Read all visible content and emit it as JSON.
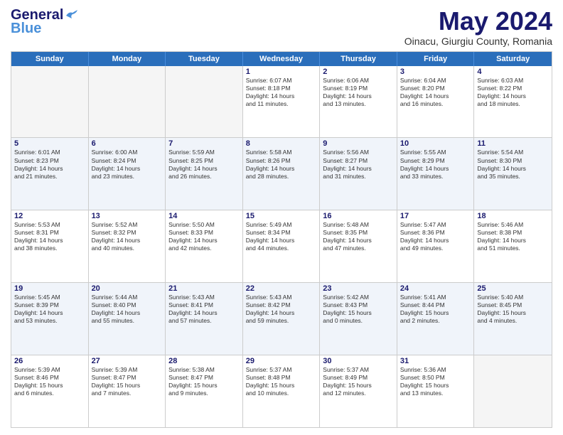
{
  "header": {
    "logo_line1": "General",
    "logo_line2": "Blue",
    "main_title": "May 2024",
    "subtitle": "Oinacu, Giurgiu County, Romania"
  },
  "calendar": {
    "days_of_week": [
      "Sunday",
      "Monday",
      "Tuesday",
      "Wednesday",
      "Thursday",
      "Friday",
      "Saturday"
    ],
    "weeks": [
      {
        "alt": false,
        "cells": [
          {
            "day": "",
            "empty": true,
            "lines": []
          },
          {
            "day": "",
            "empty": true,
            "lines": []
          },
          {
            "day": "",
            "empty": true,
            "lines": []
          },
          {
            "day": "1",
            "empty": false,
            "lines": [
              "Sunrise: 6:07 AM",
              "Sunset: 8:18 PM",
              "Daylight: 14 hours",
              "and 11 minutes."
            ]
          },
          {
            "day": "2",
            "empty": false,
            "lines": [
              "Sunrise: 6:06 AM",
              "Sunset: 8:19 PM",
              "Daylight: 14 hours",
              "and 13 minutes."
            ]
          },
          {
            "day": "3",
            "empty": false,
            "lines": [
              "Sunrise: 6:04 AM",
              "Sunset: 8:20 PM",
              "Daylight: 14 hours",
              "and 16 minutes."
            ]
          },
          {
            "day": "4",
            "empty": false,
            "lines": [
              "Sunrise: 6:03 AM",
              "Sunset: 8:22 PM",
              "Daylight: 14 hours",
              "and 18 minutes."
            ]
          }
        ]
      },
      {
        "alt": true,
        "cells": [
          {
            "day": "5",
            "empty": false,
            "lines": [
              "Sunrise: 6:01 AM",
              "Sunset: 8:23 PM",
              "Daylight: 14 hours",
              "and 21 minutes."
            ]
          },
          {
            "day": "6",
            "empty": false,
            "lines": [
              "Sunrise: 6:00 AM",
              "Sunset: 8:24 PM",
              "Daylight: 14 hours",
              "and 23 minutes."
            ]
          },
          {
            "day": "7",
            "empty": false,
            "lines": [
              "Sunrise: 5:59 AM",
              "Sunset: 8:25 PM",
              "Daylight: 14 hours",
              "and 26 minutes."
            ]
          },
          {
            "day": "8",
            "empty": false,
            "lines": [
              "Sunrise: 5:58 AM",
              "Sunset: 8:26 PM",
              "Daylight: 14 hours",
              "and 28 minutes."
            ]
          },
          {
            "day": "9",
            "empty": false,
            "lines": [
              "Sunrise: 5:56 AM",
              "Sunset: 8:27 PM",
              "Daylight: 14 hours",
              "and 31 minutes."
            ]
          },
          {
            "day": "10",
            "empty": false,
            "lines": [
              "Sunrise: 5:55 AM",
              "Sunset: 8:29 PM",
              "Daylight: 14 hours",
              "and 33 minutes."
            ]
          },
          {
            "day": "11",
            "empty": false,
            "lines": [
              "Sunrise: 5:54 AM",
              "Sunset: 8:30 PM",
              "Daylight: 14 hours",
              "and 35 minutes."
            ]
          }
        ]
      },
      {
        "alt": false,
        "cells": [
          {
            "day": "12",
            "empty": false,
            "lines": [
              "Sunrise: 5:53 AM",
              "Sunset: 8:31 PM",
              "Daylight: 14 hours",
              "and 38 minutes."
            ]
          },
          {
            "day": "13",
            "empty": false,
            "lines": [
              "Sunrise: 5:52 AM",
              "Sunset: 8:32 PM",
              "Daylight: 14 hours",
              "and 40 minutes."
            ]
          },
          {
            "day": "14",
            "empty": false,
            "lines": [
              "Sunrise: 5:50 AM",
              "Sunset: 8:33 PM",
              "Daylight: 14 hours",
              "and 42 minutes."
            ]
          },
          {
            "day": "15",
            "empty": false,
            "lines": [
              "Sunrise: 5:49 AM",
              "Sunset: 8:34 PM",
              "Daylight: 14 hours",
              "and 44 minutes."
            ]
          },
          {
            "day": "16",
            "empty": false,
            "lines": [
              "Sunrise: 5:48 AM",
              "Sunset: 8:35 PM",
              "Daylight: 14 hours",
              "and 47 minutes."
            ]
          },
          {
            "day": "17",
            "empty": false,
            "lines": [
              "Sunrise: 5:47 AM",
              "Sunset: 8:36 PM",
              "Daylight: 14 hours",
              "and 49 minutes."
            ]
          },
          {
            "day": "18",
            "empty": false,
            "lines": [
              "Sunrise: 5:46 AM",
              "Sunset: 8:38 PM",
              "Daylight: 14 hours",
              "and 51 minutes."
            ]
          }
        ]
      },
      {
        "alt": true,
        "cells": [
          {
            "day": "19",
            "empty": false,
            "lines": [
              "Sunrise: 5:45 AM",
              "Sunset: 8:39 PM",
              "Daylight: 14 hours",
              "and 53 minutes."
            ]
          },
          {
            "day": "20",
            "empty": false,
            "lines": [
              "Sunrise: 5:44 AM",
              "Sunset: 8:40 PM",
              "Daylight: 14 hours",
              "and 55 minutes."
            ]
          },
          {
            "day": "21",
            "empty": false,
            "lines": [
              "Sunrise: 5:43 AM",
              "Sunset: 8:41 PM",
              "Daylight: 14 hours",
              "and 57 minutes."
            ]
          },
          {
            "day": "22",
            "empty": false,
            "lines": [
              "Sunrise: 5:43 AM",
              "Sunset: 8:42 PM",
              "Daylight: 14 hours",
              "and 59 minutes."
            ]
          },
          {
            "day": "23",
            "empty": false,
            "lines": [
              "Sunrise: 5:42 AM",
              "Sunset: 8:43 PM",
              "Daylight: 15 hours",
              "and 0 minutes."
            ]
          },
          {
            "day": "24",
            "empty": false,
            "lines": [
              "Sunrise: 5:41 AM",
              "Sunset: 8:44 PM",
              "Daylight: 15 hours",
              "and 2 minutes."
            ]
          },
          {
            "day": "25",
            "empty": false,
            "lines": [
              "Sunrise: 5:40 AM",
              "Sunset: 8:45 PM",
              "Daylight: 15 hours",
              "and 4 minutes."
            ]
          }
        ]
      },
      {
        "alt": false,
        "cells": [
          {
            "day": "26",
            "empty": false,
            "lines": [
              "Sunrise: 5:39 AM",
              "Sunset: 8:46 PM",
              "Daylight: 15 hours",
              "and 6 minutes."
            ]
          },
          {
            "day": "27",
            "empty": false,
            "lines": [
              "Sunrise: 5:39 AM",
              "Sunset: 8:47 PM",
              "Daylight: 15 hours",
              "and 7 minutes."
            ]
          },
          {
            "day": "28",
            "empty": false,
            "lines": [
              "Sunrise: 5:38 AM",
              "Sunset: 8:47 PM",
              "Daylight: 15 hours",
              "and 9 minutes."
            ]
          },
          {
            "day": "29",
            "empty": false,
            "lines": [
              "Sunrise: 5:37 AM",
              "Sunset: 8:48 PM",
              "Daylight: 15 hours",
              "and 10 minutes."
            ]
          },
          {
            "day": "30",
            "empty": false,
            "lines": [
              "Sunrise: 5:37 AM",
              "Sunset: 8:49 PM",
              "Daylight: 15 hours",
              "and 12 minutes."
            ]
          },
          {
            "day": "31",
            "empty": false,
            "lines": [
              "Sunrise: 5:36 AM",
              "Sunset: 8:50 PM",
              "Daylight: 15 hours",
              "and 13 minutes."
            ]
          },
          {
            "day": "",
            "empty": true,
            "lines": []
          }
        ]
      }
    ]
  }
}
